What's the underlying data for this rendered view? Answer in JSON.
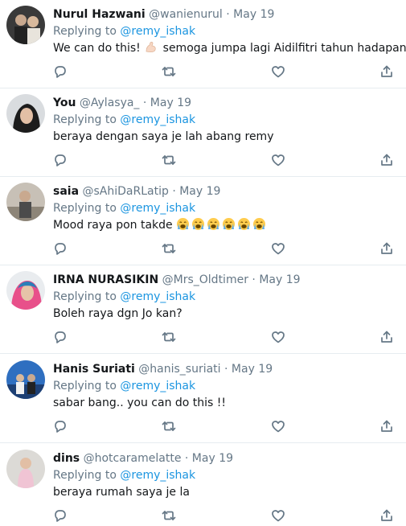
{
  "replying_label": "Replying to",
  "tweets": [
    {
      "name": "Nurul Hazwani",
      "handle": "@wanienurul",
      "dot": "·",
      "date": "May 19",
      "mention": "@remy_ishak",
      "text": "We can do this!",
      "text_after": " semoga jumpa lagi Aidilfitri tahun hadapan",
      "emoji": "flexed-biceps"
    },
    {
      "name": "You",
      "handle": "@Aylasya_",
      "dot": "·",
      "date": "May 19",
      "mention": "@remy_ishak",
      "text": "beraya dengan saya je lah abang remy"
    },
    {
      "name": "saia",
      "handle": "@sAhiDaRLatip",
      "dot": "·",
      "date": "May 19",
      "mention": "@remy_ishak",
      "text": "Mood raya pon takde",
      "emoji": "loudly-crying-face",
      "emoji_count": 6
    },
    {
      "name": "IRNA NURASIKIN",
      "handle": "@Mrs_Oldtimer",
      "dot": "·",
      "date": "May 19",
      "mention": "@remy_ishak",
      "text": "Boleh raya dgn Jo kan?"
    },
    {
      "name": "Hanis Suriati",
      "handle": "@hanis_suriati",
      "dot": "·",
      "date": "May 19",
      "mention": "@remy_ishak",
      "text": "sabar bang.. you can do this !!"
    },
    {
      "name": "dins",
      "handle": "@hotcaramelatte",
      "dot": "·",
      "date": "May 19",
      "mention": "@remy_ishak",
      "text": "beraya rumah saya je la"
    }
  ],
  "colors": {
    "name": "#14171a",
    "secondary": "#657786",
    "link": "#1b95e0",
    "divider": "#e6ecf0"
  },
  "icons": [
    "reply-icon",
    "retweet-icon",
    "like-icon",
    "share-icon"
  ]
}
